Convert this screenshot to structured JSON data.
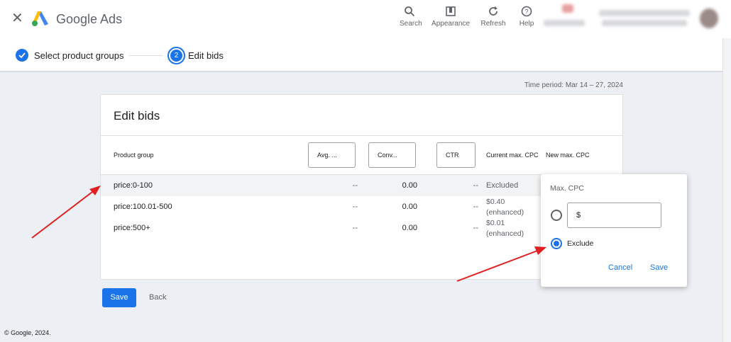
{
  "header": {
    "app_title": "Google Ads",
    "tools": [
      {
        "label": "Search",
        "icon": "search-icon"
      },
      {
        "label": "Appearance",
        "icon": "appearance-icon"
      },
      {
        "label": "Refresh",
        "icon": "refresh-icon"
      },
      {
        "label": "Help",
        "icon": "help-icon"
      }
    ]
  },
  "stepper": {
    "steps": [
      {
        "label": "Select product groups",
        "state": "complete"
      },
      {
        "label": "Edit bids",
        "number": "2",
        "state": "current"
      }
    ]
  },
  "time_period": "Time period: Mar 14 – 27, 2024",
  "card": {
    "title": "Edit bids",
    "columns": {
      "product_group": "Product group",
      "avg": "Avg. ...",
      "conv": "Conv...",
      "ctr": "CTR",
      "current_cpc": "Current max. CPC",
      "new_cpc": "New max. CPC"
    },
    "rows": [
      {
        "group": "price:0-100",
        "avg": "--",
        "conv": "0.00",
        "ctr": "--",
        "current": "Excluded",
        "current_sub": ""
      },
      {
        "group": "price:100.01-500",
        "avg": "--",
        "conv": "0.00",
        "ctr": "--",
        "current": "$0.40",
        "current_sub": "(enhanced)"
      },
      {
        "group": "price:500+",
        "avg": "--",
        "conv": "0.00",
        "ctr": "--",
        "current": "$0.01",
        "current_sub": "(enhanced)"
      }
    ]
  },
  "popup": {
    "title": "Max. CPC",
    "input_prefix": "$",
    "exclude_label": "Exclude",
    "cancel": "Cancel",
    "save": "Save"
  },
  "actions": {
    "save": "Save",
    "back": "Back"
  },
  "footer": "© Google, 2024.",
  "colors": {
    "accent": "#1a73e8",
    "annotation_arrow": "#e02020"
  }
}
